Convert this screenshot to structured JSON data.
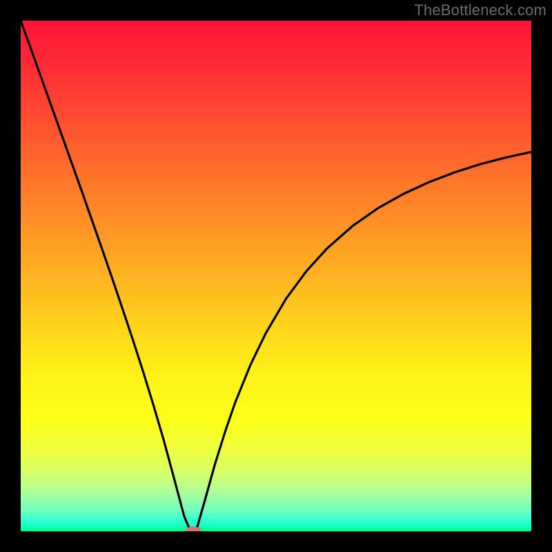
{
  "watermark": "TheBottleneck.com",
  "gradient": {
    "stops": [
      {
        "offset": 0.0,
        "color": "#ff1438"
      },
      {
        "offset": 0.1,
        "color": "#ff2f35"
      },
      {
        "offset": 0.2,
        "color": "#ff5030"
      },
      {
        "offset": 0.3,
        "color": "#ff712b"
      },
      {
        "offset": 0.4,
        "color": "#ff9226"
      },
      {
        "offset": 0.5,
        "color": "#ffb321"
      },
      {
        "offset": 0.6,
        "color": "#ffd41c"
      },
      {
        "offset": 0.7,
        "color": "#fff317"
      },
      {
        "offset": 0.78,
        "color": "#fdff18"
      },
      {
        "offset": 0.83,
        "color": "#f1ff36"
      },
      {
        "offset": 0.88,
        "color": "#daff63"
      },
      {
        "offset": 0.92,
        "color": "#b3ff95"
      },
      {
        "offset": 0.96,
        "color": "#6effbf"
      },
      {
        "offset": 0.985,
        "color": "#1effd6"
      },
      {
        "offset": 1.0,
        "color": "#00ff7a"
      }
    ]
  },
  "chart_data": {
    "type": "line",
    "title": "",
    "xlabel": "",
    "ylabel": "",
    "xlim": [
      0,
      100
    ],
    "ylim": [
      0,
      100
    ],
    "x": [
      0,
      2,
      4,
      6,
      8,
      10,
      12,
      14,
      16,
      18,
      20,
      22,
      24,
      26,
      28,
      30,
      32,
      33,
      33.8,
      34.5,
      36,
      38,
      40,
      42,
      45,
      48,
      52,
      56,
      60,
      65,
      70,
      75,
      80,
      85,
      90,
      95,
      100
    ],
    "values": [
      100,
      94.5,
      88.9,
      83.3,
      77.7,
      72.1,
      66.5,
      60.8,
      55.1,
      49.3,
      43.4,
      37.4,
      31.2,
      24.7,
      17.9,
      10.5,
      3.0,
      0.6,
      0.0,
      0.6,
      5.8,
      13.0,
      19.4,
      25.2,
      32.6,
      38.8,
      45.6,
      51.0,
      55.4,
      59.8,
      63.3,
      66.1,
      68.4,
      70.3,
      71.9,
      73.2,
      74.3
    ],
    "marker": {
      "x": 33.8,
      "y": 0.0,
      "rx": 1.6,
      "ry": 0.95
    },
    "grid": false,
    "legend": false
  }
}
